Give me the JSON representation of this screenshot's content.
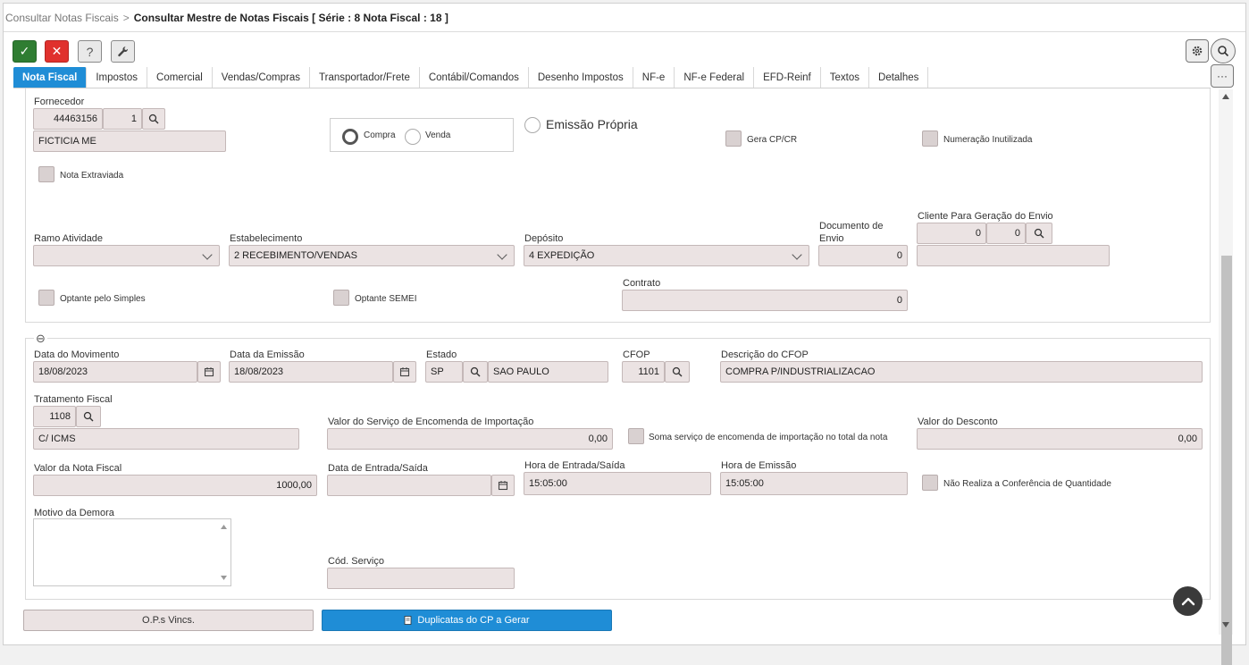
{
  "breadcrumb": {
    "parent": "Consultar Notas Fiscais",
    "separator": ">",
    "current": "Consultar Mestre de Notas Fiscais [ Série : 8 Nota Fiscal : 18 ]"
  },
  "toolbar": {
    "confirm_glyph": "✓",
    "cancel_glyph": "✕",
    "help_glyph": "?",
    "more_glyph": "···"
  },
  "tabs": [
    "Nota Fiscal",
    "Impostos",
    "Comercial",
    "Vendas/Compras",
    "Transportador/Frete",
    "Contábil/Comandos",
    "Desenho Impostos",
    "NF-e",
    "NF-e Federal",
    "EFD-Reinf",
    "Textos",
    "Detalhes"
  ],
  "section1": {
    "fornecedor": {
      "label": "Fornecedor",
      "code": "44463156",
      "seq": "1",
      "name": "FICTICIA ME"
    },
    "tipo": {
      "compra": "Compra",
      "venda": "Venda",
      "selected": "Compra"
    },
    "emissao_propria": "Emissão Própria",
    "gera_cp_cr": "Gera CP/CR",
    "numeracao_inutilizada": "Numeração Inutilizada",
    "nota_extraviada": "Nota Extraviada",
    "ramo_atividade": {
      "label": "Ramo Atividade",
      "value": ""
    },
    "estabelecimento": {
      "label": "Estabelecimento",
      "value": "2 RECEBIMENTO/VENDAS"
    },
    "deposito": {
      "label": "Depósito",
      "value": "4 EXPEDIÇÃO"
    },
    "documento_envio": {
      "label_line1": "Documento de",
      "label_line2": "Envio",
      "value": "0"
    },
    "cliente_envio": {
      "label": "Cliente Para Geração do Envio",
      "code": "0",
      "seq": "0",
      "name": ""
    },
    "optante_simples": "Optante pelo Simples",
    "optante_semei": "Optante SEMEI",
    "contrato": {
      "label": "Contrato",
      "value": "0"
    }
  },
  "section2": {
    "collapse_glyph": "⊖",
    "data_movimento": {
      "label": "Data do Movimento",
      "value": "18/08/2023"
    },
    "data_emissao": {
      "label": "Data da Emissão",
      "value": "18/08/2023"
    },
    "estado": {
      "label": "Estado",
      "uf": "SP",
      "name": "SAO PAULO"
    },
    "cfop": {
      "label": "CFOP",
      "value": "1101"
    },
    "descricao_cfop": {
      "label": "Descrição do CFOP",
      "value": "COMPRA P/INDUSTRIALIZACAO"
    },
    "tratamento_fiscal": {
      "label": "Tratamento Fiscal",
      "code": "1108",
      "desc": "C/ ICMS"
    },
    "valor_servico_importacao": {
      "label": "Valor do Serviço de Encomenda de Importação",
      "value": "0,00"
    },
    "soma_servico": "Soma serviço de encomenda de importação no total da nota",
    "valor_desconto": {
      "label": "Valor do Desconto",
      "value": "0,00"
    },
    "valor_nota": {
      "label": "Valor da Nota Fiscal",
      "value": "1000,00"
    },
    "data_entrada_saida": {
      "label": "Data de Entrada/Saída",
      "value": ""
    },
    "hora_entrada_saida": {
      "label": "Hora de Entrada/Saída",
      "value": "15:05:00"
    },
    "hora_emissao": {
      "label": "Hora de Emissão",
      "value": "15:05:00"
    },
    "nao_realiza_conferencia": "Não Realiza a Conferência de Quantidade",
    "motivo_demora": {
      "label": "Motivo da Demora",
      "value": ""
    },
    "cod_servico": {
      "label": "Cód. Serviço",
      "value": ""
    }
  },
  "buttons": {
    "ops_vincs": "O.P.s Vincs.",
    "duplicatas": "Duplicatas do CP a Gerar"
  },
  "colors": {
    "primary": "#1f8dd6",
    "confirm": "#2f7d32",
    "cancel": "#e0312d",
    "field_bg": "#ebe3e3"
  }
}
